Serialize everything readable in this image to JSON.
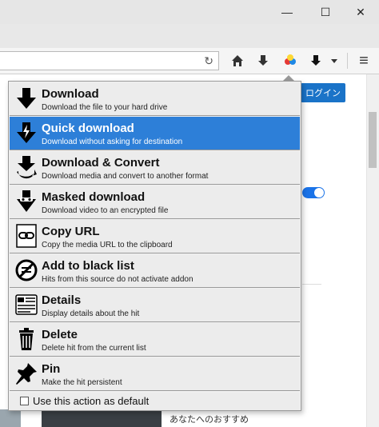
{
  "window": {
    "minimize_glyph": "—",
    "maximize_glyph": "☐",
    "close_glyph": "✕"
  },
  "toolbar": {
    "reload_glyph": "↻",
    "menu_glyph": "≡"
  },
  "page": {
    "login_label": "ログイン",
    "recommend_text": "あなたへのおすすめ"
  },
  "menu": {
    "items": [
      {
        "title": "Download",
        "desc": "Download the file to your hard drive",
        "icon": "download-arrow-icon"
      },
      {
        "title": "Quick download",
        "desc": "Download without asking for destination",
        "icon": "quick-download-icon"
      },
      {
        "title": "Download & Convert",
        "desc": "Download media and convert to another format",
        "icon": "download-convert-icon"
      },
      {
        "title": "Masked download",
        "desc": "Download video to an encrypted file",
        "icon": "masked-download-icon"
      },
      {
        "title": "Copy URL",
        "desc": "Copy the media URL to the clipboard",
        "icon": "link-icon"
      },
      {
        "title": "Add to black list",
        "desc": "Hits from this source do not activate addon",
        "icon": "blacklist-icon"
      },
      {
        "title": "Details",
        "desc": "Display details about the hit",
        "icon": "details-icon"
      },
      {
        "title": "Delete",
        "desc": "Delete hit from the current list",
        "icon": "trash-icon"
      },
      {
        "title": "Pin",
        "desc": "Make the hit persistent",
        "icon": "pin-icon"
      }
    ],
    "selected_index": 1,
    "default_checkbox_label": "Use this action as default",
    "default_checked": false
  },
  "colors": {
    "selected": "#2d7fd8",
    "item_bg": "#ececec",
    "login": "#1a73c8"
  }
}
